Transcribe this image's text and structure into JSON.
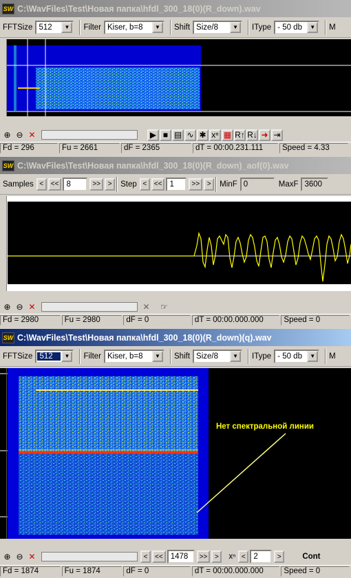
{
  "app_icon": "SW",
  "windows": [
    {
      "title": "C:\\WavFiles\\Test\\Новая папка\\hfdl_300_18(0)(R_down).wav",
      "toolbar": {
        "fftsize_label": "FFTSize",
        "fftsize_value": "512",
        "filter_label": "Filter",
        "filter_value": "Kiser, b=8",
        "shift_label": "Shift",
        "shift_value": "Size/8",
        "itype_label": "IType",
        "itype_value": "- 50 db",
        "overflow_label": "M"
      },
      "status": {
        "fd": "Fd = 296",
        "fu": "Fu = 2661",
        "df": "dF = 2365",
        "dt": "dT = 00:00.231.111",
        "speed": "Speed = 4.33"
      }
    },
    {
      "title": "C:\\WavFiles\\Test\\Новая папка\\hfdl_300_18(0)(R_down)_aof(0).wav",
      "toolbar": {
        "samples_label": "Samples",
        "samples_value": "8",
        "step_label": "Step",
        "step_value": "1",
        "minf_label": "MinF",
        "minf_value": "0",
        "maxf_label": "MaxF",
        "maxf_value": "3600"
      },
      "status": {
        "fd": "Fd = 2980",
        "fu": "Fu = 2980",
        "df": "dF = 0",
        "dt": "dT = 00:00.000.000",
        "speed": "Speed = 0"
      }
    },
    {
      "title": "C:\\WavFiles\\Test\\Новая папка\\hfdl_300_18(0)(R_down)(q).wav",
      "toolbar": {
        "fftsize_label": "FFTSize",
        "fftsize_value": "512",
        "filter_label": "Filter",
        "filter_value": "Kiser, b=8",
        "shift_label": "Shift",
        "shift_value": "Size/8",
        "itype_label": "IType",
        "itype_value": "- 50 db",
        "overflow_label": "M"
      },
      "annotation": "Нет спектральной линии",
      "nav": {
        "position_value": "1478",
        "power_label": "xⁿ",
        "power_value": "2",
        "cont_label": "Cont"
      },
      "status": {
        "fd": "Fd = 1874",
        "fu": "Fu = 1874",
        "df": "dF = 0",
        "dt": "dT = 00:00.000.000",
        "speed": "Speed = 0"
      }
    }
  ],
  "colors": {
    "spectrogram_bg": "#0000cc",
    "spectrogram_noise": "#1060ff",
    "waveform": "#ffff00",
    "marker_line": "#ff3000",
    "annotation_text": "#ffff00"
  },
  "icons": [
    "zoom-in-icon",
    "zoom-out-icon",
    "clear-icon",
    "play-icon",
    "stop-icon",
    "spectrum-icon",
    "markers-icon",
    "power-icon",
    "palette-icon",
    "rotate-right-icon",
    "rotate-left-icon",
    "export-icon",
    "exit-icon",
    "hand-pointer-icon"
  ]
}
